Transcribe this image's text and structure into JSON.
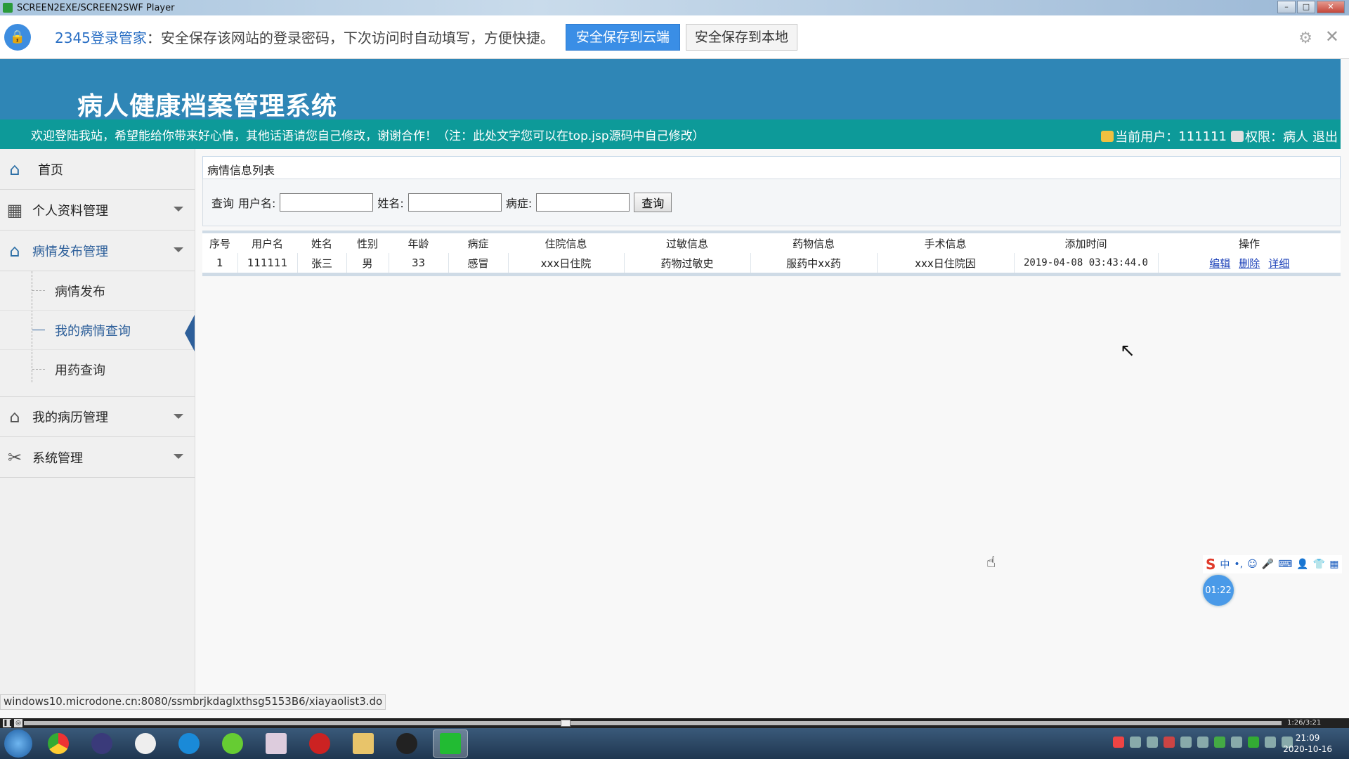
{
  "window": {
    "title": "SCREEN2EXE/SCREEN2SWF Player",
    "controls": [
      "–",
      "□",
      "✕"
    ]
  },
  "pwbar": {
    "brand": "2345登录管家",
    "message": "：安全保存该网站的登录密码，下次访问时自动填写，方便快捷。",
    "save_cloud": "安全保存到云端",
    "save_local": "安全保存到本地"
  },
  "header": {
    "system_title": "病人健康档案管理系统",
    "welcome": "欢迎登陆我站，希望能给你带来好心情，其他话语请您自己修改，谢谢合作！（注：此处文字您可以在top.jsp源码中自己修改）",
    "current_user_label": "当前用户：",
    "current_user": "111111",
    "role_label": "权限：",
    "role": "病人",
    "logout": "退出"
  },
  "sidebar": {
    "home": "首页",
    "profile": "个人资料管理",
    "condition_publish": "病情发布管理",
    "sub": [
      "病情发布",
      "我的病情查询",
      "用药查询"
    ],
    "records": "我的病历管理",
    "system": "系统管理"
  },
  "main": {
    "panel_title": "病情信息列表",
    "search": {
      "query_label": "查询",
      "username_label": "用户名:",
      "name_label": "姓名:",
      "disease_label": "病症:",
      "button": "查询"
    },
    "table": {
      "headers": [
        "序号",
        "用户名",
        "姓名",
        "性别",
        "年龄",
        "病症",
        "住院信息",
        "过敏信息",
        "药物信息",
        "手术信息",
        "添加时间",
        "操作"
      ],
      "row": [
        "1",
        "111111",
        "张三",
        "男",
        "33",
        "感冒",
        "xxx日住院",
        "药物过敏史",
        "服药中xx药",
        "xxx日住院因",
        "2019-04-08 03:43:44.0"
      ],
      "actions": [
        "编辑",
        "删除",
        "详细"
      ]
    }
  },
  "status_url": "windows10.microdone.cn:8080/ssmbrjkdaglxthsg5153B6/xiayaolist3.do",
  "ime": {
    "logo": "S",
    "mode": "中"
  },
  "timer": "01:22",
  "player": {
    "time": "1:26/3:21"
  },
  "clock": {
    "time": "21:09",
    "date": "2020-10-16"
  }
}
